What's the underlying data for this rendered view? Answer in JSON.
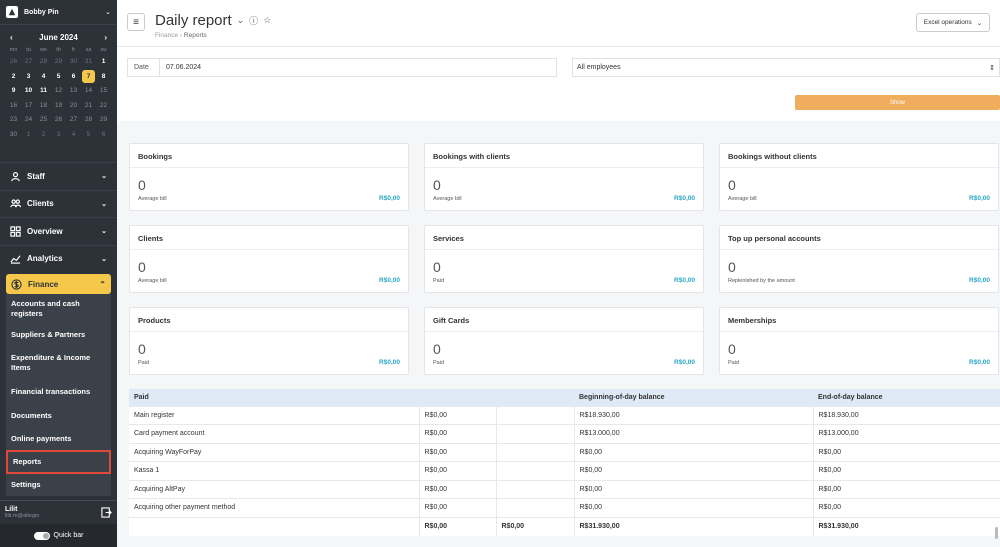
{
  "sidebar": {
    "user": "Bobby Pin",
    "calendar": {
      "month": "June 2024",
      "dow": [
        "mo",
        "tu",
        "we",
        "th",
        "fr",
        "sa",
        "su"
      ],
      "days": [
        {
          "d": "26",
          "s": "muted"
        },
        {
          "d": "27",
          "s": "muted"
        },
        {
          "d": "28",
          "s": "muted"
        },
        {
          "d": "29",
          "s": "muted"
        },
        {
          "d": "30",
          "s": "muted"
        },
        {
          "d": "31",
          "s": "muted"
        },
        {
          "d": "1",
          "s": ""
        },
        {
          "d": "2",
          "s": ""
        },
        {
          "d": "3",
          "s": ""
        },
        {
          "d": "4",
          "s": ""
        },
        {
          "d": "5",
          "s": ""
        },
        {
          "d": "6",
          "s": ""
        },
        {
          "d": "7",
          "s": "sel"
        },
        {
          "d": "8",
          "s": ""
        },
        {
          "d": "9",
          "s": ""
        },
        {
          "d": "10",
          "s": ""
        },
        {
          "d": "11",
          "s": ""
        },
        {
          "d": "12",
          "s": "dim"
        },
        {
          "d": "13",
          "s": "dim"
        },
        {
          "d": "14",
          "s": "dim"
        },
        {
          "d": "15",
          "s": "dim"
        },
        {
          "d": "16",
          "s": "dim"
        },
        {
          "d": "17",
          "s": "dim"
        },
        {
          "d": "18",
          "s": "dim"
        },
        {
          "d": "19",
          "s": "dim"
        },
        {
          "d": "20",
          "s": "dim"
        },
        {
          "d": "21",
          "s": "dim"
        },
        {
          "d": "22",
          "s": "dim"
        },
        {
          "d": "23",
          "s": "dim"
        },
        {
          "d": "24",
          "s": "dim"
        },
        {
          "d": "25",
          "s": "dim"
        },
        {
          "d": "26",
          "s": "dim"
        },
        {
          "d": "27",
          "s": "dim"
        },
        {
          "d": "28",
          "s": "dim"
        },
        {
          "d": "29",
          "s": "dim"
        },
        {
          "d": "30",
          "s": "dim"
        },
        {
          "d": "1",
          "s": "muted"
        },
        {
          "d": "2",
          "s": "muted"
        },
        {
          "d": "3",
          "s": "muted"
        },
        {
          "d": "4",
          "s": "muted"
        },
        {
          "d": "5",
          "s": "muted"
        },
        {
          "d": "6",
          "s": "muted"
        }
      ]
    },
    "nav": {
      "staff": "Staff",
      "clients": "Clients",
      "overview": "Overview",
      "analytics": "Analytics",
      "finance": "Finance"
    },
    "finance_sub": {
      "accounts": "Accounts and cash registers",
      "suppliers": "Suppliers & Partners",
      "expenditure": "Expenditure & Income Items",
      "transactions": "Financial transactions",
      "documents": "Documents",
      "online": "Online payments",
      "reports": "Reports",
      "settings": "Settings"
    },
    "account": {
      "name": "Lilit",
      "email": "lilit.m@altegio"
    },
    "quick_bar": "Quick bar"
  },
  "header": {
    "title": "Daily report",
    "breadcrumb_parent": "Finance",
    "breadcrumb_sep": "›",
    "breadcrumb_current": "Reports",
    "excel": "Excel operations"
  },
  "filters": {
    "date_label": "Date",
    "date_value": "07.06.2024",
    "employees": "All employees",
    "show": "Show"
  },
  "cards": [
    {
      "title": "Bookings",
      "value": "0",
      "sub": "Average bill",
      "amount": "R$0,00"
    },
    {
      "title": "Bookings with clients",
      "value": "0",
      "sub": "Average bill",
      "amount": "R$0,00"
    },
    {
      "title": "Bookings without clients",
      "value": "0",
      "sub": "Average bill",
      "amount": "R$0,00"
    },
    {
      "title": "Clients",
      "value": "0",
      "sub": "Average bill",
      "amount": "R$0,00"
    },
    {
      "title": "Services",
      "value": "0",
      "sub": "Paid",
      "amount": "R$0,00"
    },
    {
      "title": "Top up personal accounts",
      "value": "0",
      "sub": "Replenished by the amount",
      "amount": "R$0,00"
    },
    {
      "title": "Products",
      "value": "0",
      "sub": "Paid",
      "amount": "R$0,00"
    },
    {
      "title": "Gift Cards",
      "value": "0",
      "sub": "Paid",
      "amount": "R$0,00"
    },
    {
      "title": "Memberships",
      "value": "0",
      "sub": "Paid",
      "amount": "R$0,00"
    }
  ],
  "table": {
    "headers": [
      "Paid",
      "",
      "",
      "Beginning-of-day balance",
      "End-of-day balance"
    ],
    "rows": [
      [
        "Main register",
        "R$0,00",
        "",
        "R$18.930,00",
        "R$18.930,00"
      ],
      [
        "Card payment account",
        "R$0,00",
        "",
        "R$13.000,00",
        "R$13.000,00"
      ],
      [
        "Acquiring WayForPay",
        "R$0,00",
        "",
        "R$0,00",
        "R$0,00"
      ],
      [
        "Kassa 1",
        "R$0,00",
        "",
        "R$0,00",
        "R$0,00"
      ],
      [
        "Acquiring AltPay",
        "R$0,00",
        "",
        "R$0,00",
        "R$0,00"
      ],
      [
        "Acquiring other payment method",
        "R$0,00",
        "",
        "R$0,00",
        "R$0,00"
      ]
    ],
    "total": [
      "",
      "R$0,00",
      "R$0,00",
      "R$31.930,00",
      "R$31.930,00"
    ]
  }
}
